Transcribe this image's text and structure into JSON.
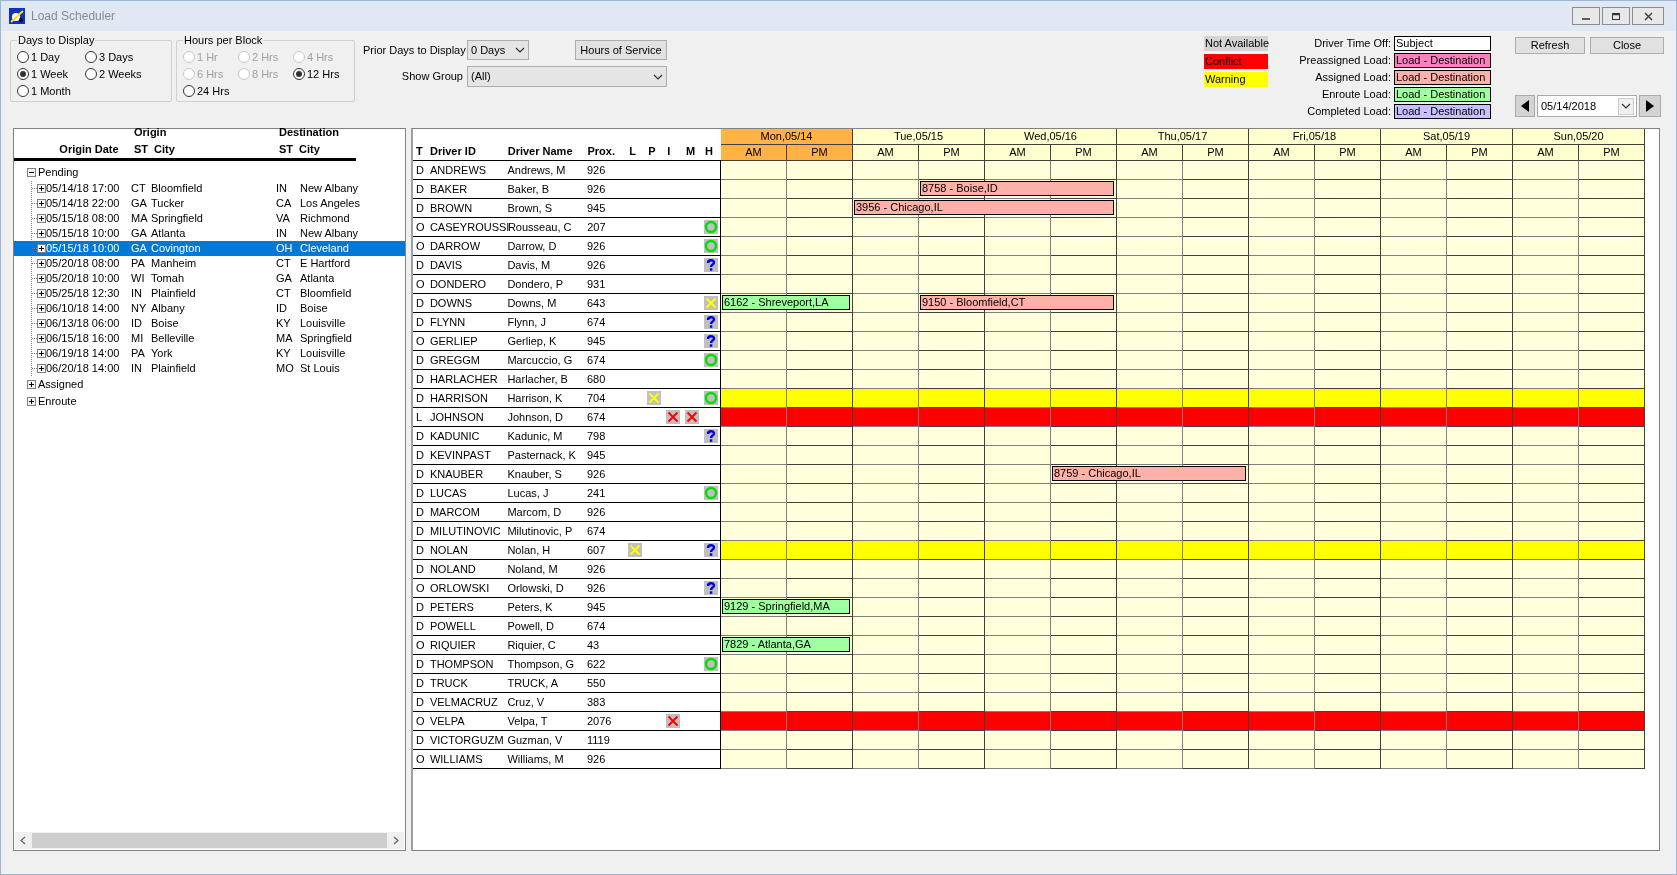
{
  "window": {
    "title": "Load Scheduler"
  },
  "days_to_display": {
    "label": "Days to Display",
    "options": [
      {
        "label": "1 Day",
        "selected": false
      },
      {
        "label": "3 Days",
        "selected": false
      },
      {
        "label": "1 Week",
        "selected": true
      },
      {
        "label": "2 Weeks",
        "selected": false
      },
      {
        "label": "1 Month",
        "selected": false
      }
    ]
  },
  "hours_per_block": {
    "label": "Hours per Block",
    "options": [
      {
        "label": "1 Hr",
        "selected": false,
        "disabled": true
      },
      {
        "label": "2 Hrs",
        "selected": false,
        "disabled": true
      },
      {
        "label": "4 Hrs",
        "selected": false,
        "disabled": true
      },
      {
        "label": "6 Hrs",
        "selected": false,
        "disabled": true
      },
      {
        "label": "8 Hrs",
        "selected": false,
        "disabled": true
      },
      {
        "label": "12 Hrs",
        "selected": true,
        "disabled": false
      },
      {
        "label": "24 Hrs",
        "selected": false,
        "disabled": false
      }
    ]
  },
  "prior_days": {
    "label": "Prior Days to Display",
    "value": "0 Days"
  },
  "hours_of_service_button": "Hours of Service",
  "show_group": {
    "label": "Show Group",
    "value": "(All)"
  },
  "status_legend": [
    {
      "label": "Not Available",
      "color": "#d4d4d4"
    },
    {
      "label": "Conflict",
      "color": "#ff0000"
    },
    {
      "label": "Warning",
      "color": "#ffff00"
    }
  ],
  "load_legend": [
    {
      "label": "Driver Time Off:",
      "sample": "Subject",
      "color": "#ffffff"
    },
    {
      "label": "Preassigned Load:",
      "sample": "Load - Destination",
      "color": "#ff80c0"
    },
    {
      "label": "Assigned Load:",
      "sample": "Load - Destination",
      "color": "#ffb0a8"
    },
    {
      "label": "Enroute Load:",
      "sample": "Load - Destination",
      "color": "#a0ffa0"
    },
    {
      "label": "Completed Load:",
      "sample": "Load - Destination",
      "color": "#c8c0ff"
    }
  ],
  "buttons": [
    "Refresh",
    "Close"
  ],
  "date": "05/14/2018",
  "loads_tree": {
    "header": {
      "origin": "Origin",
      "destination": "Destination",
      "origin_date": "Origin Date",
      "origin_st": "ST",
      "origin_city": "City",
      "dest_st": "ST",
      "dest_city": "City"
    },
    "groups": [
      {
        "label": "Pending",
        "expanded": true,
        "children": [
          {
            "date": "05/14/18 17:00",
            "origin_st": "CT",
            "origin_city": "Bloomfield",
            "dest_st": "IN",
            "dest_city": "New Albany",
            "selected": false
          },
          {
            "date": "05/14/18 22:00",
            "origin_st": "GA",
            "origin_city": "Tucker",
            "dest_st": "CA",
            "dest_city": "Los Angeles",
            "selected": false
          },
          {
            "date": "05/15/18 08:00",
            "origin_st": "MA",
            "origin_city": "Springfield",
            "dest_st": "VA",
            "dest_city": "Richmond",
            "selected": false
          },
          {
            "date": "05/15/18 10:00",
            "origin_st": "GA",
            "origin_city": "Atlanta",
            "dest_st": "IN",
            "dest_city": "New Albany",
            "selected": false
          },
          {
            "date": "05/15/18 10:00",
            "origin_st": "GA",
            "origin_city": "Covington",
            "dest_st": "OH",
            "dest_city": "Cleveland",
            "selected": true
          },
          {
            "date": "05/20/18 08:00",
            "origin_st": "PA",
            "origin_city": "Manheim",
            "dest_st": "CT",
            "dest_city": "E Hartford",
            "selected": false
          },
          {
            "date": "05/20/18 10:00",
            "origin_st": "WI",
            "origin_city": "Tomah",
            "dest_st": "GA",
            "dest_city": "Atlanta",
            "selected": false
          },
          {
            "date": "05/25/18 12:30",
            "origin_st": "IN",
            "origin_city": "Plainfield",
            "dest_st": "CT",
            "dest_city": "Bloomfield",
            "selected": false
          },
          {
            "date": "06/10/18 14:00",
            "origin_st": "NY",
            "origin_city": "Albany",
            "dest_st": "ID",
            "dest_city": "Boise",
            "selected": false
          },
          {
            "date": "06/13/18 06:00",
            "origin_st": "ID",
            "origin_city": "Boise",
            "dest_st": "KY",
            "dest_city": "Louisville",
            "selected": false
          },
          {
            "date": "06/15/18 16:00",
            "origin_st": "MI",
            "origin_city": "Belleville",
            "dest_st": "MA",
            "dest_city": "Springfield",
            "selected": false
          },
          {
            "date": "06/19/18 14:00",
            "origin_st": "PA",
            "origin_city": "York",
            "dest_st": "KY",
            "dest_city": "Louisville",
            "selected": false
          },
          {
            "date": "06/20/18 14:00",
            "origin_st": "IN",
            "origin_city": "Plainfield",
            "dest_st": "MO",
            "dest_city": "St Louis",
            "selected": false
          }
        ]
      },
      {
        "label": "Assigned",
        "expanded": false
      },
      {
        "label": "Enroute",
        "expanded": false
      }
    ]
  },
  "drivers": {
    "columns": [
      "T",
      "Driver ID",
      "Driver Name",
      "Prox.",
      "L",
      "P",
      "I",
      "M",
      "H"
    ],
    "rows": [
      {
        "type": "D",
        "id": "ANDREWS",
        "name": "Andrews, M",
        "prox": "926",
        "kind": "normal"
      },
      {
        "type": "D",
        "id": "BAKER",
        "name": "Baker, B",
        "prox": "926",
        "kind": "normal",
        "loads": [
          {
            "label": "8758 - Boise,ID",
            "kind": "assigned",
            "blocks": [
              false,
              false,
              false,
              true,
              true,
              true,
              false,
              false,
              false,
              false,
              false,
              false,
              false,
              false
            ]
          }
        ]
      },
      {
        "type": "D",
        "id": "BROWN",
        "name": "Brown, S",
        "prox": "945",
        "kind": "normal",
        "loads": [
          {
            "label": "3956 - Chicago,IL",
            "kind": "assigned",
            "blocks": [
              false,
              false,
              true,
              true,
              true,
              true,
              false,
              false,
              false,
              false,
              false,
              false,
              false,
              false
            ]
          }
        ]
      },
      {
        "type": "O",
        "id": "CASEYROUSSI",
        "name": "Rousseau, C",
        "prox": "207",
        "kind": "normal",
        "flags": {
          "h": {
            "kind": "circle"
          }
        }
      },
      {
        "type": "O",
        "id": "DARROW",
        "name": "Darrow, D",
        "prox": "926",
        "kind": "normal",
        "flags": {
          "h": {
            "kind": "circle"
          }
        }
      },
      {
        "type": "D",
        "id": "DAVIS",
        "name": "Davis, M",
        "prox": "926",
        "kind": "normal",
        "flags": {
          "h": {
            "kind": "question"
          }
        }
      },
      {
        "type": "O",
        "id": "DONDERO",
        "name": "Dondero, P",
        "prox": "931",
        "kind": "normal"
      },
      {
        "type": "D",
        "id": "DOWNS",
        "name": "Downs, M",
        "prox": "643",
        "kind": "normal",
        "flags": {
          "h": {
            "kind": "yellow_x"
          }
        },
        "loads": [
          {
            "label": "6162 - Shreveport,LA",
            "kind": "enroute",
            "blocks": [
              true,
              true,
              false,
              false,
              false,
              false,
              false,
              false,
              false,
              false,
              false,
              false,
              false,
              false
            ]
          },
          {
            "label": "9150 - Bloomfield,CT",
            "kind": "assigned",
            "blocks": [
              false,
              false,
              false,
              true,
              true,
              true,
              false,
              false,
              false,
              false,
              false,
              false,
              false,
              false
            ]
          }
        ]
      },
      {
        "type": "D",
        "id": "FLYNN",
        "name": "Flynn, J",
        "prox": "674",
        "kind": "normal",
        "flags": {
          "h": {
            "kind": "question"
          }
        }
      },
      {
        "type": "O",
        "id": "GERLIEP",
        "name": "Gerliep, K",
        "prox": "945",
        "kind": "normal",
        "flags": {
          "h": {
            "kind": "question"
          }
        }
      },
      {
        "type": "D",
        "id": "GREGGM",
        "name": "Marcuccio, G",
        "prox": "674",
        "kind": "normal",
        "flags": {
          "h": {
            "kind": "circle"
          }
        }
      },
      {
        "type": "D",
        "id": "HARLACHER",
        "name": "Harlacher, B",
        "prox": "680",
        "kind": "normal"
      },
      {
        "type": "D",
        "id": "HARRISON",
        "name": "Harrison, K",
        "prox": "704",
        "kind": "warning",
        "flags": {
          "p": {
            "kind": "yellow_x"
          },
          "h": {
            "kind": "circle"
          }
        }
      },
      {
        "type": "L",
        "id": "JOHNSON",
        "name": "Johnson, D",
        "prox": "674",
        "kind": "conflict",
        "flags": {
          "i": {
            "kind": "red_x"
          },
          "m": {
            "kind": "red_x"
          }
        }
      },
      {
        "type": "D",
        "id": "KADUNIC",
        "name": "Kadunic, M",
        "prox": "798",
        "kind": "normal",
        "flags": {
          "h": {
            "kind": "question"
          }
        }
      },
      {
        "type": "D",
        "id": "KEVINPAST",
        "name": "Pasternack, K",
        "prox": "945",
        "kind": "normal"
      },
      {
        "type": "D",
        "id": "KNAUBER",
        "name": "Knauber, S",
        "prox": "926",
        "kind": "normal",
        "loads": [
          {
            "label": "8759 - Chicago,IL",
            "kind": "assigned",
            "blocks": [
              false,
              false,
              false,
              false,
              false,
              true,
              true,
              true,
              false,
              false,
              false,
              false,
              false,
              false
            ]
          }
        ]
      },
      {
        "type": "D",
        "id": "LUCAS",
        "name": "Lucas, J",
        "prox": "241",
        "kind": "normal",
        "flags": {
          "h": {
            "kind": "circle"
          }
        }
      },
      {
        "type": "D",
        "id": "MARCOM",
        "name": "Marcom, D",
        "prox": "926",
        "kind": "normal"
      },
      {
        "type": "D",
        "id": "MILUTINOVIC",
        "name": "Milutinovic, P",
        "prox": "674",
        "kind": "normal"
      },
      {
        "type": "D",
        "id": "NOLAN",
        "name": "Nolan, H",
        "prox": "607",
        "kind": "warning",
        "flags": {
          "l": {
            "kind": "yellow_x"
          },
          "h": {
            "kind": "question"
          }
        }
      },
      {
        "type": "D",
        "id": "NOLAND",
        "name": "Noland, M",
        "prox": "926",
        "kind": "normal"
      },
      {
        "type": "O",
        "id": "ORLOWSKI",
        "name": "Orlowski, D",
        "prox": "926",
        "kind": "normal",
        "flags": {
          "h": {
            "kind": "question"
          }
        }
      },
      {
        "type": "D",
        "id": "PETERS",
        "name": "Peters, K",
        "prox": "945",
        "kind": "normal",
        "loads": [
          {
            "label": "9129 - Springfield,MA",
            "kind": "enroute",
            "blocks": [
              true,
              true,
              false,
              false,
              false,
              false,
              false,
              false,
              false,
              false,
              false,
              false,
              false,
              false
            ]
          }
        ]
      },
      {
        "type": "D",
        "id": "POWELL",
        "name": "Powell, D",
        "prox": "674",
        "kind": "normal"
      },
      {
        "type": "O",
        "id": "RIQUIER",
        "name": "Riquier, C",
        "prox": "43",
        "kind": "normal",
        "loads": [
          {
            "label": "7829 - Atlanta,GA",
            "kind": "enroute",
            "blocks": [
              true,
              true,
              false,
              false,
              false,
              false,
              false,
              false,
              false,
              false,
              false,
              false,
              false,
              false
            ]
          }
        ]
      },
      {
        "type": "D",
        "id": "THOMPSON",
        "name": "Thompson, G",
        "prox": "622",
        "kind": "normal",
        "flags": {
          "h": {
            "kind": "circle"
          }
        }
      },
      {
        "type": "D",
        "id": "TRUCK",
        "name": "TRUCK, A",
        "prox": "550",
        "kind": "normal"
      },
      {
        "type": "D",
        "id": "VELMACRUZ",
        "name": "Cruz, V",
        "prox": "383",
        "kind": "normal"
      },
      {
        "type": "O",
        "id": "VELPA",
        "name": "Velpa, T",
        "prox": "2076",
        "kind": "conflict",
        "flags": {
          "i": {
            "kind": "red_x"
          }
        }
      },
      {
        "type": "D",
        "id": "VICTORGUZM",
        "name": "Guzman, V",
        "prox": "1119",
        "kind": "normal"
      },
      {
        "type": "O",
        "id": "WILLIAMS",
        "name": "Williams, M",
        "prox": "926",
        "kind": "normal"
      }
    ]
  },
  "schedule": {
    "days": [
      {
        "label": "Mon,05/14",
        "selected": true,
        "halves": [
          "AM",
          "PM"
        ]
      },
      {
        "label": "Tue,05/15",
        "selected": false,
        "halves": [
          "AM",
          "PM"
        ]
      },
      {
        "label": "Wed,05/16",
        "selected": false,
        "halves": [
          "AM",
          "PM"
        ]
      },
      {
        "label": "Thu,05/17",
        "selected": false,
        "halves": [
          "AM",
          "PM"
        ]
      },
      {
        "label": "Fri,05/18",
        "selected": false,
        "halves": [
          "AM",
          "PM"
        ]
      },
      {
        "label": "Sat,05/19",
        "selected": false,
        "halves": [
          "AM",
          "PM"
        ]
      },
      {
        "label": "Sun,05/20",
        "selected": false,
        "halves": [
          "AM",
          "PM"
        ]
      }
    ]
  }
}
